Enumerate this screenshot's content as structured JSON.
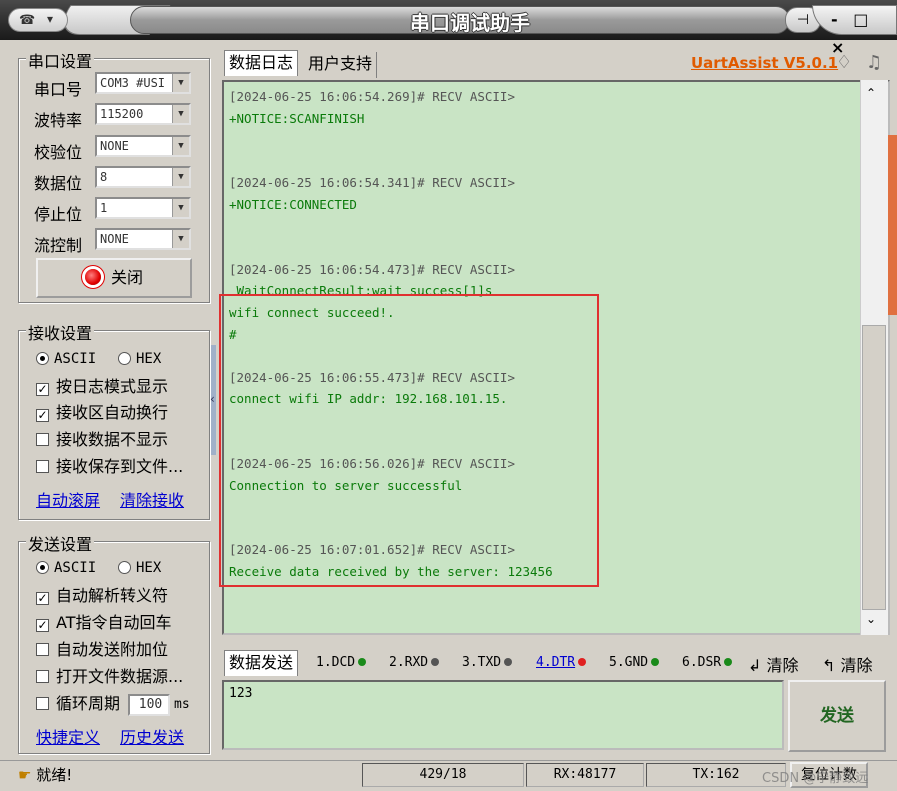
{
  "titlebar": {
    "title": "串口调试助手",
    "menu_logo": "☎",
    "pin": "⊣",
    "controls": "- □ ×"
  },
  "serial_settings": {
    "group_title": "串口设置",
    "port_label": "串口号",
    "port_value": "COM3 #USI",
    "baud_label": "波特率",
    "baud_value": "115200",
    "parity_label": "校验位",
    "parity_value": "NONE",
    "databits_label": "数据位",
    "databits_value": "8",
    "stopbits_label": "停止位",
    "stopbits_value": "1",
    "flow_label": "流控制",
    "flow_value": "NONE",
    "close_button": "关闭"
  },
  "receive_settings": {
    "group_title": "接收设置",
    "ascii": "ASCII",
    "hex": "HEX",
    "log_mode": "按日志模式显示",
    "auto_wrap": "接收区自动换行",
    "no_display": "接收数据不显示",
    "save_to_file": "接收保存到文件...",
    "auto_scroll": "自动滚屏",
    "clear_receive": "清除接收"
  },
  "send_settings": {
    "group_title": "发送设置",
    "ascii": "ASCII",
    "hex": "HEX",
    "escape": "自动解析转义符",
    "at_cr": "AT指令自动回车",
    "append": "自动发送附加位",
    "open_file": "打开文件数据源...",
    "cycle": "循环周期",
    "cycle_value": "100",
    "cycle_unit": "ms",
    "shortcuts": "快捷定义",
    "history": "历史发送"
  },
  "tabs": {
    "log": "数据日志",
    "support": "用户支持",
    "version": "UartAssist V5.0.1"
  },
  "log": [
    {
      "header": "[2024-06-25 16:06:54.269]# RECV ASCII>",
      "lines": [
        "+NOTICE:SCANFINISH"
      ]
    },
    {
      "header": "[2024-06-25 16:06:54.341]# RECV ASCII>",
      "lines": [
        "+NOTICE:CONNECTED"
      ]
    },
    {
      "header": "[2024-06-25 16:06:54.473]# RECV ASCII>",
      "lines": [
        " WaitConnectResult:wait success[1]s",
        "wifi connect succeed!.",
        "#"
      ]
    },
    {
      "header": "[2024-06-25 16:06:55.473]# RECV ASCII>",
      "lines": [
        "connect wifi IP addr: 192.168.101.15."
      ]
    },
    {
      "header": "[2024-06-25 16:06:56.026]# RECV ASCII>",
      "lines": [
        "Connection to server successful"
      ]
    },
    {
      "header": "[2024-06-25 16:07:01.652]# RECV ASCII>",
      "lines": [
        "Receive data received by the server: 123456"
      ]
    }
  ],
  "sendbar": {
    "tab": "数据发送",
    "signals": [
      {
        "label": "1.DCD",
        "color": "#1a8a1a"
      },
      {
        "label": "2.RXD",
        "color": "#555555"
      },
      {
        "label": "3.TXD",
        "color": "#555555"
      },
      {
        "label": "4.DTR",
        "color": "#e02020"
      },
      {
        "label": "5.GND",
        "color": "#1a8a1a"
      },
      {
        "label": "6.DSR",
        "color": "#1a8a1a"
      }
    ],
    "clear1": "清除",
    "clear2": "清除",
    "input_value": "123",
    "send_button": "发送"
  },
  "status": {
    "ready": "就绪!",
    "counter": "429/18",
    "rx": "RX:48177",
    "tx": "TX:162",
    "reset": "复位计数",
    "watermark": "CSDN @宁静致远"
  }
}
